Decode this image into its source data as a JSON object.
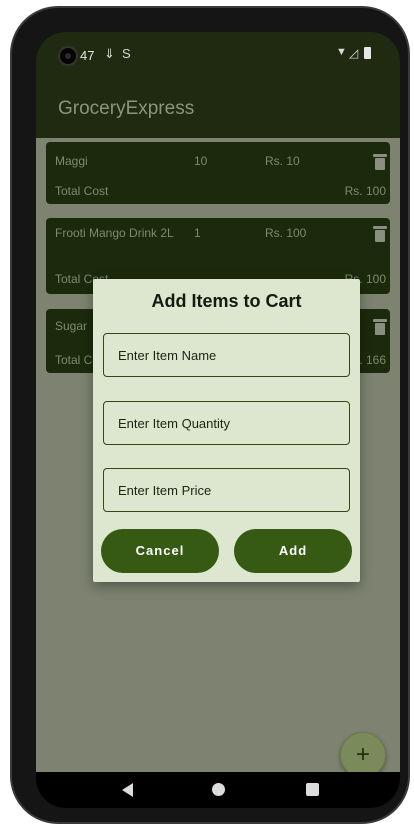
{
  "status_bar": {
    "time": "47",
    "left_icons": [
      "download-icon",
      "s-shield-icon"
    ],
    "right_icons": [
      "wifi-icon",
      "signal-icon",
      "battery-icon"
    ]
  },
  "app_bar": {
    "title": "GroceryExpress"
  },
  "cart": {
    "items": [
      {
        "name": "Maggi",
        "quantity": "10",
        "price": "Rs. 10",
        "total_label": "Total Cost",
        "total_value": "Rs. 100"
      },
      {
        "name": "Frooti Mango Drink 2L",
        "quantity": "1",
        "price": "Rs. 100",
        "total_label": "Total Cost",
        "total_value": "Rs. 100"
      },
      {
        "name": "Sugar",
        "quantity": "",
        "price": "",
        "total_label": "Total Cost",
        "total_value": "Rs. 166"
      }
    ]
  },
  "dialog": {
    "title": "Add Items to Cart",
    "name_placeholder": "Enter Item Name",
    "quantity_placeholder": "Enter Item Quantity",
    "price_placeholder": "Enter Item Price",
    "cancel_label": "Cancel",
    "add_label": "Add"
  },
  "fab": {
    "label": "+"
  },
  "colors": {
    "primary": "#365a14",
    "app_bar": "#1f2a10",
    "dialog_bg": "#dde6cf"
  }
}
